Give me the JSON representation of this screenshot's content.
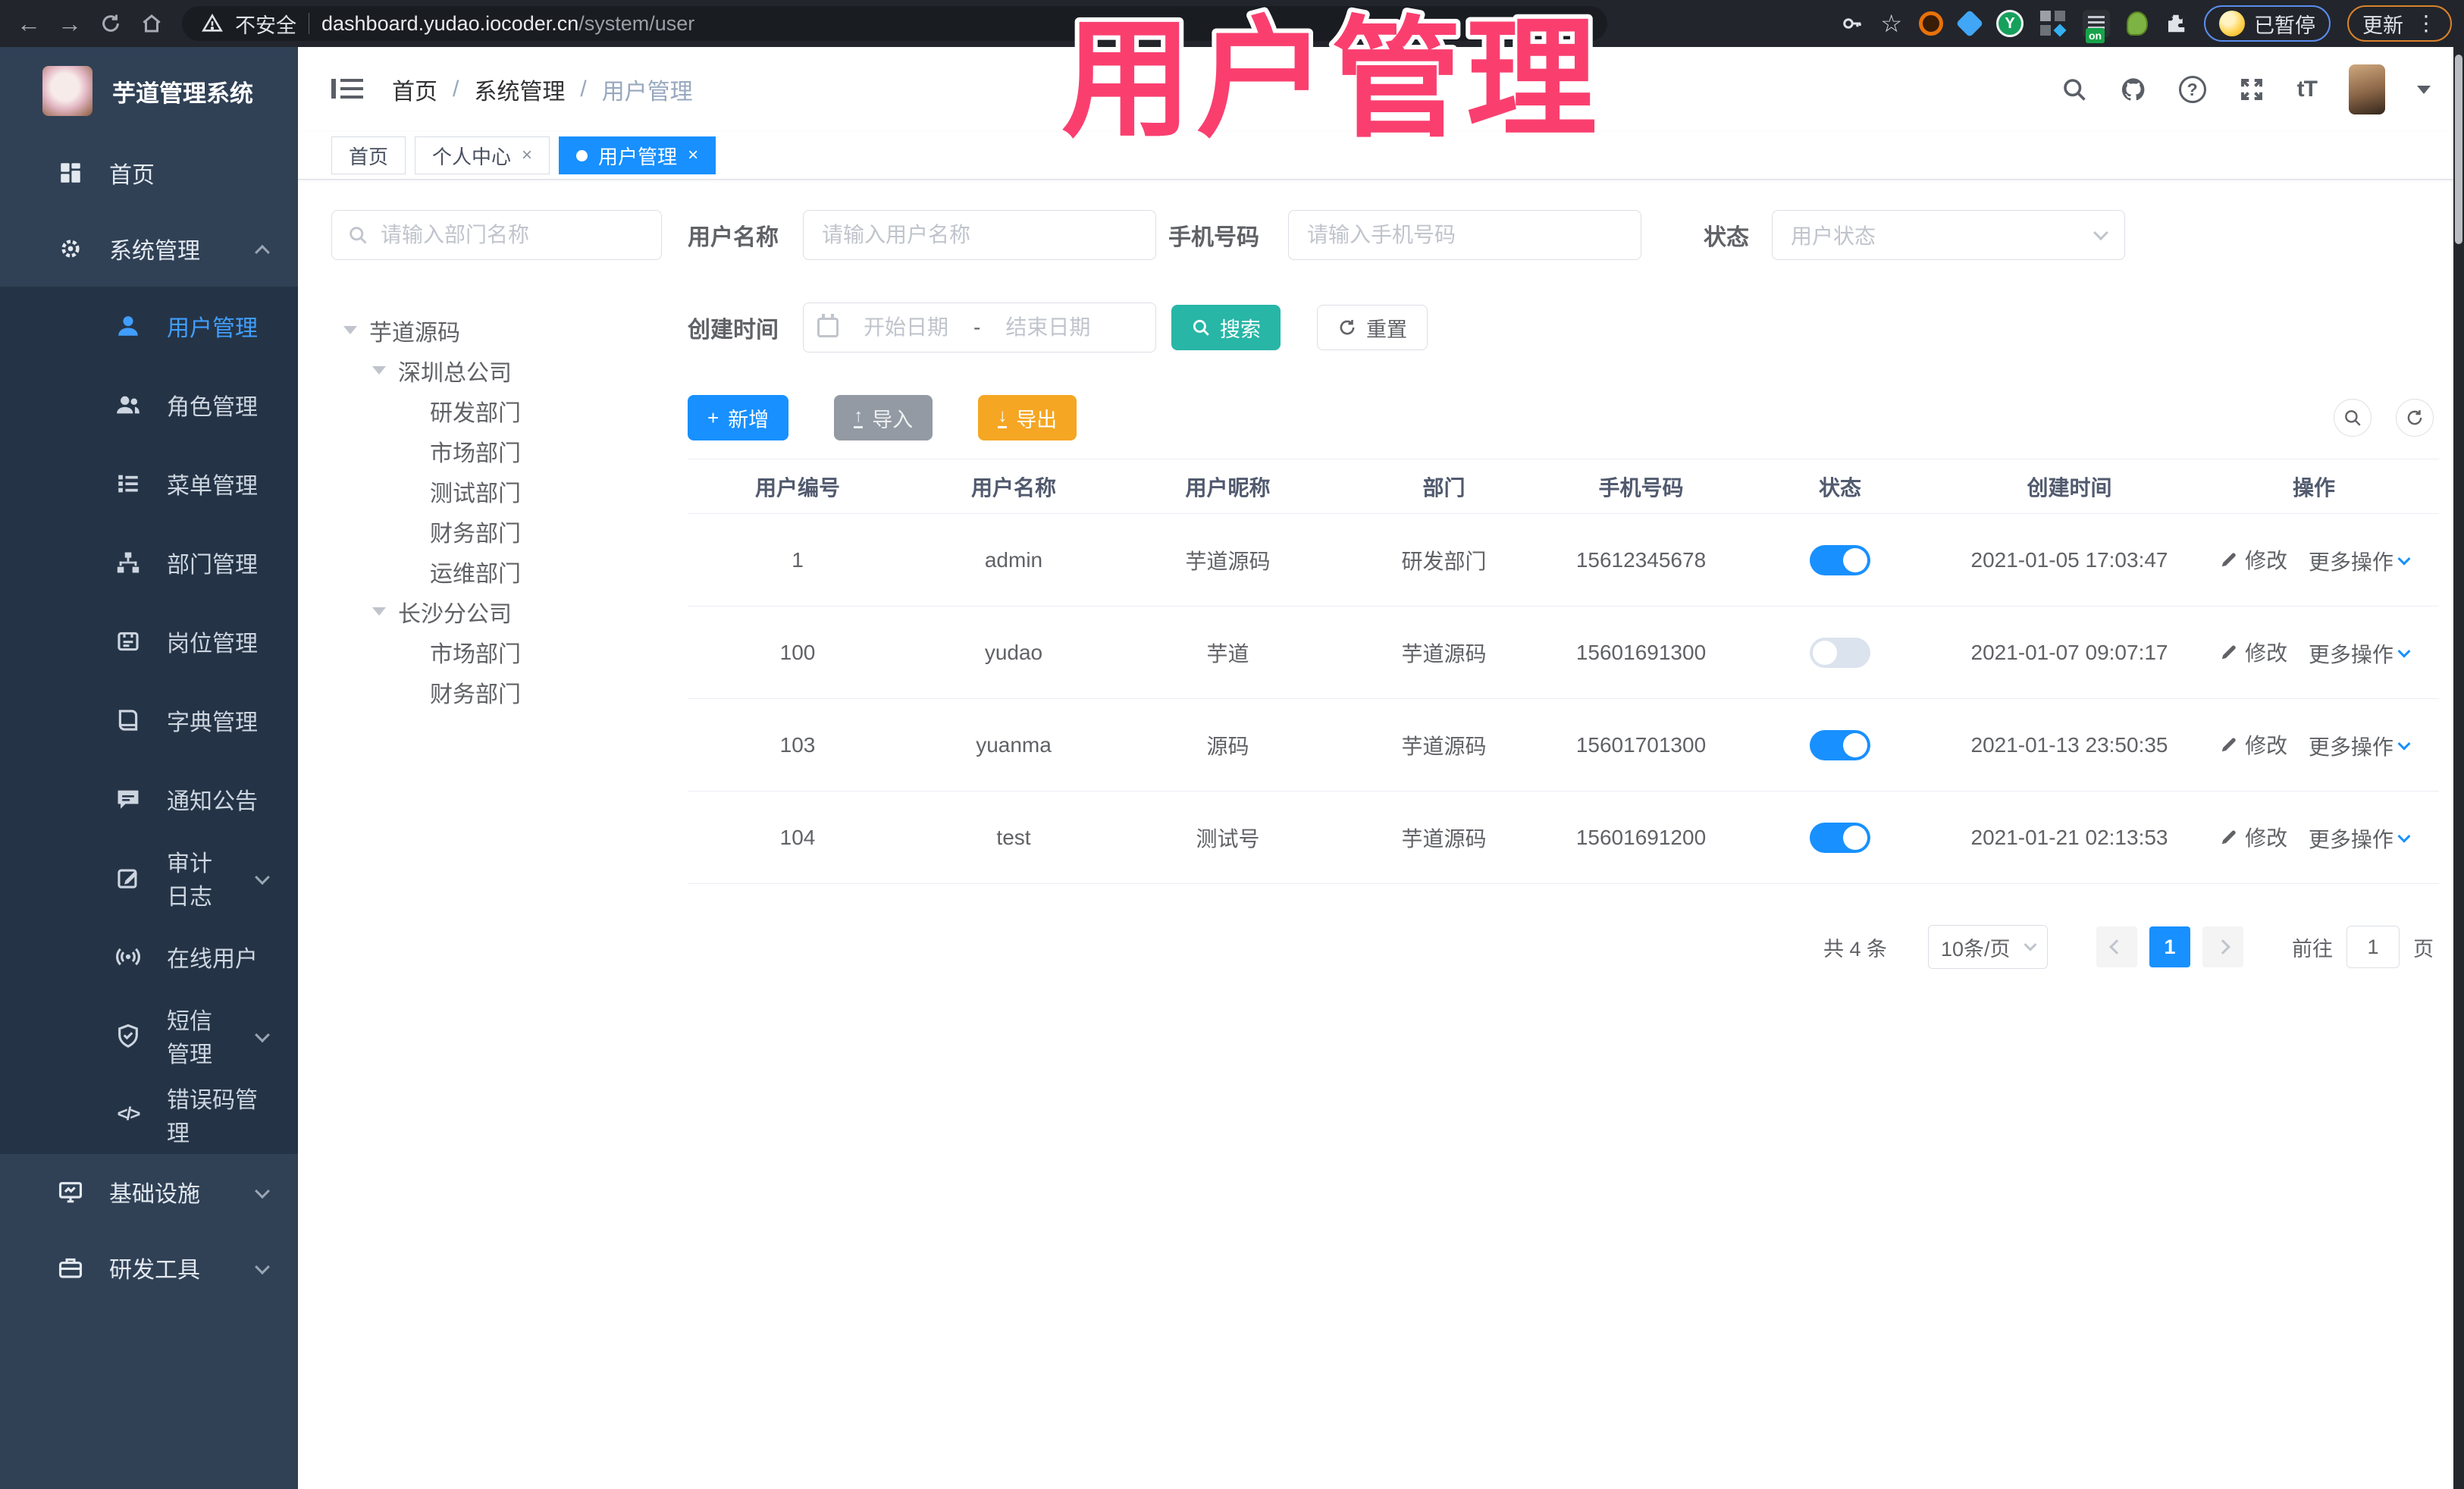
{
  "colors": {
    "accent_blue": "#1890ff",
    "sidebar_active_blue": "#409eff",
    "sidebar_bg": "#304156",
    "submenu_bg": "#243446",
    "search_teal": "#28b6a7",
    "export_amber": "#f5a623",
    "import_gray": "#939aa3",
    "overlay_pink": "#fa3f6f"
  },
  "browser": {
    "security_label": "不安全",
    "url_host": "dashboard.yudao.iocoder.cn",
    "url_path": "/system/user",
    "extension_on_badge": "on",
    "paused_badge": "已暂停",
    "update_button": "更新"
  },
  "overlay_title": "用户管理",
  "sidebar": {
    "app_title": "芋道管理系统",
    "items": [
      {
        "label": "首页",
        "icon": "dashboard-icon"
      },
      {
        "label": "系统管理",
        "icon": "gear-icon",
        "expanded": true
      },
      {
        "label": "用户管理",
        "icon": "user-icon",
        "active": true
      },
      {
        "label": "角色管理",
        "icon": "users-icon"
      },
      {
        "label": "菜单管理",
        "icon": "menu-list-icon"
      },
      {
        "label": "部门管理",
        "icon": "org-tree-icon"
      },
      {
        "label": "岗位管理",
        "icon": "id-badge-icon"
      },
      {
        "label": "字典管理",
        "icon": "dictionary-icon"
      },
      {
        "label": "通知公告",
        "icon": "announcement-icon"
      },
      {
        "label": "审计日志",
        "icon": "audit-log-icon",
        "collapsible": true
      },
      {
        "label": "在线用户",
        "icon": "online-users-icon"
      },
      {
        "label": "短信管理",
        "icon": "sms-icon",
        "collapsible": true
      },
      {
        "label": "错误码管理",
        "icon": "error-code-icon"
      },
      {
        "label": "基础设施",
        "icon": "infrastructure-icon",
        "collapsible": true
      },
      {
        "label": "研发工具",
        "icon": "dev-tools-icon",
        "collapsible": true
      }
    ]
  },
  "header": {
    "breadcrumb": [
      "首页",
      "系统管理",
      "用户管理"
    ]
  },
  "tabs": [
    {
      "label": "首页",
      "active": false,
      "closable": false
    },
    {
      "label": "个人中心",
      "active": false,
      "closable": true
    },
    {
      "label": "用户管理",
      "active": true,
      "closable": true
    }
  ],
  "dept_panel": {
    "search_placeholder": "请输入部门名称",
    "nodes": [
      {
        "label": "芋道源码",
        "level": 0,
        "expanded": true
      },
      {
        "label": "深圳总公司",
        "level": 1,
        "expanded": true
      },
      {
        "label": "研发部门",
        "level": 2
      },
      {
        "label": "市场部门",
        "level": 2
      },
      {
        "label": "测试部门",
        "level": 2
      },
      {
        "label": "财务部门",
        "level": 2
      },
      {
        "label": "运维部门",
        "level": 2
      },
      {
        "label": "长沙分公司",
        "level": 1,
        "expanded": true
      },
      {
        "label": "市场部门",
        "level": 2
      },
      {
        "label": "财务部门",
        "level": 2
      }
    ]
  },
  "filters": {
    "username_label": "用户名称",
    "username_placeholder": "请输入用户名称",
    "mobile_label": "手机号码",
    "mobile_placeholder": "请输入手机号码",
    "status_label": "状态",
    "status_placeholder": "用户状态",
    "created_label": "创建时间",
    "date_start_placeholder": "开始日期",
    "date_separator": "-",
    "date_end_placeholder": "结束日期",
    "search_button": "搜索",
    "reset_button": "重置"
  },
  "toolbar": {
    "add_button": "新增",
    "import_button": "导入",
    "export_button": "导出"
  },
  "table": {
    "columns": [
      "用户编号",
      "用户名称",
      "用户昵称",
      "部门",
      "手机号码",
      "状态",
      "创建时间",
      "操作"
    ],
    "action_edit": "修改",
    "action_more": "更多操作",
    "rows": [
      {
        "id": "1",
        "username": "admin",
        "nickname": "芋道源码",
        "dept": "研发部门",
        "mobile": "15612345678",
        "status_on": true,
        "created": "2021-01-05 17:03:47"
      },
      {
        "id": "100",
        "username": "yudao",
        "nickname": "芋道",
        "dept": "芋道源码",
        "mobile": "15601691300",
        "status_on": false,
        "created": "2021-01-07 09:07:17"
      },
      {
        "id": "103",
        "username": "yuanma",
        "nickname": "源码",
        "dept": "芋道源码",
        "mobile": "15601701300",
        "status_on": true,
        "created": "2021-01-13 23:50:35"
      },
      {
        "id": "104",
        "username": "test",
        "nickname": "测试号",
        "dept": "芋道源码",
        "mobile": "15601691200",
        "status_on": true,
        "created": "2021-01-21 02:13:53"
      }
    ]
  },
  "pagination": {
    "total": "共 4 条",
    "page_size": "10条/页",
    "current_page": "1",
    "goto_label": "前往",
    "goto_value": "1",
    "page_unit": "页"
  }
}
